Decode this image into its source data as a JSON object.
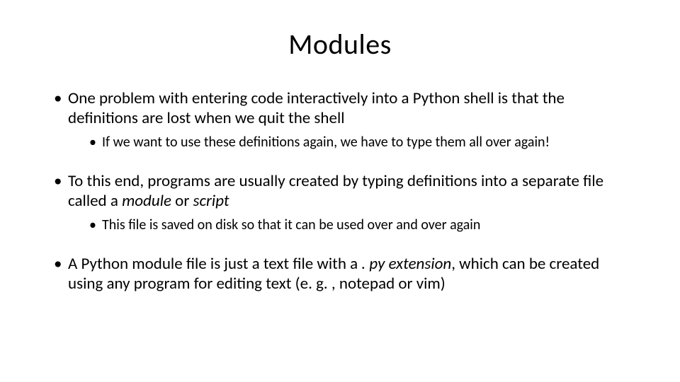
{
  "title": "Modules",
  "bullets": {
    "b1": {
      "text": "One problem with entering code interactively into a Python shell is that the definitions are lost when we quit the shell",
      "sub": "If we want to use these definitions again, we have to type them all over again!"
    },
    "b2": {
      "text_before": "To this end, programs are usually created by typing definitions into a separate file called a ",
      "italic1": "module",
      "text_mid": " or ",
      "italic2": "script",
      "sub": "This file is saved on disk so that it can be used over and over again"
    },
    "b3": {
      "text_before": "A Python module file is just a text file with a ",
      "italic": ". py extension",
      "text_after": ", which can be created using any program for editing text (e. g. , notepad or vim)"
    }
  }
}
